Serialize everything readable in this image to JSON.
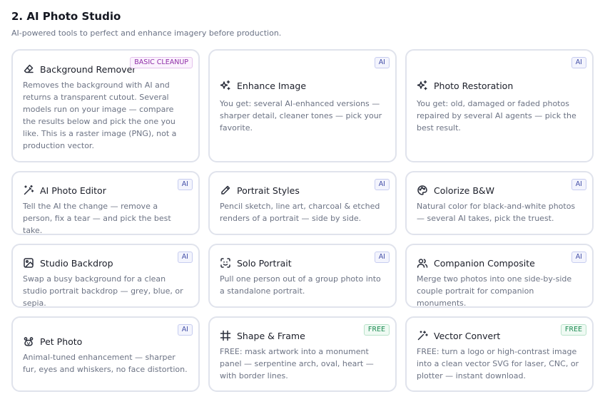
{
  "section": {
    "title": "2. AI Photo Studio",
    "subtitle": "AI-powered tools to perfect and enhance imagery before production."
  },
  "cards": [
    {
      "title": "Background Remover",
      "badge": "BASIC CLEANUP",
      "icon": "eraser-icon",
      "desc": "Removes the background with AI and returns a transparent cutout. Several models run on your image — compare the results below and pick the one you like. This is a raster image (PNG), not a production vector."
    },
    {
      "title": "Enhance Image",
      "badge": "AI",
      "icon": "sparkles-icon",
      "desc": "You get: several AI-enhanced versions — sharper detail, cleaner tones — pick your favorite."
    },
    {
      "title": "Photo Restoration",
      "badge": "AI",
      "icon": "sparkles-icon",
      "desc": "You get: old, damaged or faded photos repaired by several AI agents — pick the best result."
    },
    {
      "title": "AI Photo Editor",
      "badge": "AI",
      "icon": "magic-wand-icon",
      "desc": "Tell the AI the change — remove a person, fix a tear — and pick the best take."
    },
    {
      "title": "Portrait Styles",
      "badge": "AI",
      "icon": "pencil-icon",
      "desc": "Pencil sketch, line art, charcoal & etched renders of a portrait — side by side."
    },
    {
      "title": "Colorize B&W",
      "badge": "AI",
      "icon": "palette-icon",
      "desc": "Natural color for black-and-white photos — several AI takes, pick the truest."
    },
    {
      "title": "Studio Backdrop",
      "badge": "AI",
      "icon": "image-icon",
      "desc": "Swap a busy background for a clean studio portrait backdrop — grey, blue, or sepia."
    },
    {
      "title": "Solo Portrait",
      "badge": "AI",
      "icon": "face-scan-icon",
      "desc": "Pull one person out of a group photo into a standalone portrait."
    },
    {
      "title": "Companion Composite",
      "badge": "AI",
      "icon": "users-icon",
      "desc": "Merge two photos into one side-by-side couple portrait for companion monuments."
    },
    {
      "title": "Pet Photo",
      "badge": "AI",
      "icon": "paw-icon",
      "desc": "Animal-tuned enhancement — sharper fur, eyes and whiskers, no face distortion."
    },
    {
      "title": "Shape & Frame",
      "badge": "FREE",
      "icon": "frame-icon",
      "desc": "FREE: mask artwork into a monument panel — serpentine arch, oval, heart — with border lines."
    },
    {
      "title": "Vector Convert",
      "badge": "FREE",
      "icon": "wand-icon",
      "desc": "FREE: turn a logo or high-contrast image into a clean vector SVG for laser, CNC, or plotter — instant download."
    }
  ]
}
